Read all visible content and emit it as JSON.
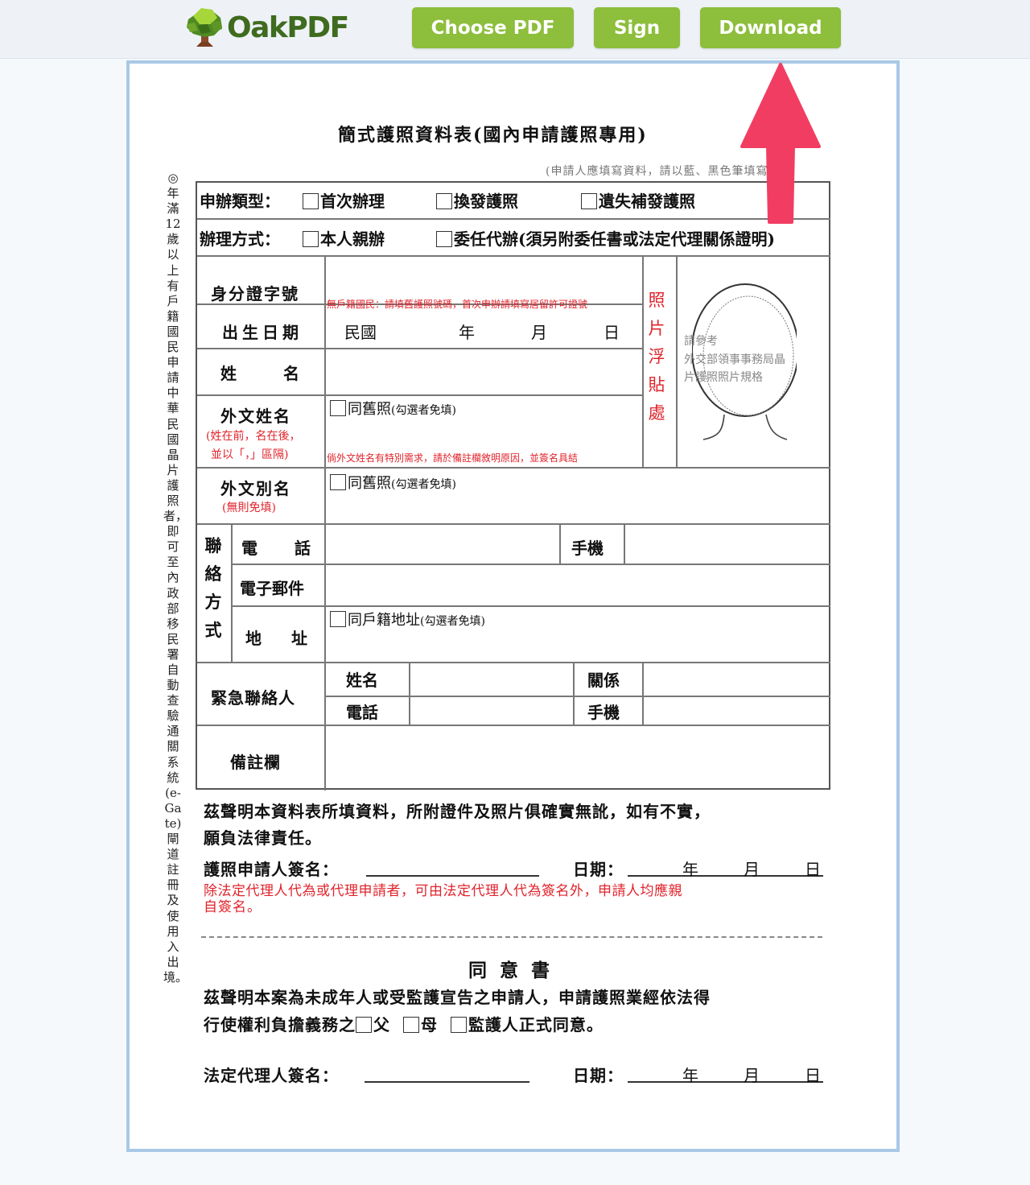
{
  "app": {
    "brand": "OakPDF",
    "toolbar": {
      "choose_pdf": "Choose PDF",
      "sign": "Sign",
      "download": "Download"
    },
    "colors": {
      "button_green": "#8dbe3c",
      "brand_green": "#3f6b1e",
      "page_border": "#a9c8e6",
      "arrow_red": "#f23d63",
      "form_red": "#e0242c"
    },
    "annotation": "red-arrow-pointing-to-download"
  },
  "document": {
    "title": "簡式護照資料表(國內申請護照專用)",
    "subtitle": "(申請人應填寫資料，請以藍、黑色筆填寫)",
    "side_note": "◎年滿12歲以上有戶籍國民申請中華民國晶片護照者，即可至內政部移民署自動查驗通關系統(e-Gate)閘道註冊及使用入出境。",
    "application_type": {
      "label": "申辦類型：",
      "options": [
        "首次辦理",
        "換發護照",
        "遺失補發護照"
      ]
    },
    "processing_method": {
      "label": "辦理方式：",
      "options": [
        "本人親辦",
        "委任代辦(須另附委任書或法定代理關係證明)"
      ]
    },
    "fields": {
      "id_number": {
        "label": "身分證字號",
        "note": "無戶籍國民：請填舊護照號碼，首次申辦請填寫居留許可證號"
      },
      "birth_date": {
        "label": "出生日期",
        "era": "民國",
        "year": "年",
        "month": "月",
        "day": "日"
      },
      "name": {
        "label_1": "姓",
        "label_2": "名"
      },
      "foreign_name": {
        "label": "外文姓名",
        "sub_1": "(姓在前，名在後，",
        "sub_2": "並以「，」區隔)",
        "same_as_old": "同舊照",
        "same_hint": "(勾選者免填)",
        "note": "倘外文姓名有特別需求，請於備註欄敘明原因，並簽名具結"
      },
      "foreign_alias": {
        "label": "外文別名",
        "sub": "(無則免填)",
        "same_as_old": "同舊照",
        "same_hint": "(勾選者免填)"
      },
      "photo": {
        "label": "照片浮貼處",
        "hint_1": "請參考",
        "hint_2": "外交部領事事務局晶",
        "hint_3": "片護照照片規格"
      },
      "contact": {
        "group_label": "聯絡方式",
        "phone_1": "電",
        "phone_2": "話",
        "mobile": "手機",
        "email": "電子郵件",
        "address_1": "地",
        "address_2": "址",
        "same_household": "同戶籍地址",
        "same_hint": "(勾選者免填)"
      },
      "emergency_contact": {
        "label": "緊急聯絡人",
        "name": "姓名",
        "relation": "關係",
        "phone": "電話",
        "mobile": "手機"
      },
      "remarks": {
        "label": "備註欄"
      }
    },
    "declaration": {
      "line_1": "茲聲明本資料表所填資料，所附證件及照片俱確實無訛，如有不實，",
      "line_2": "願負法律責任。",
      "signature_label": "護照申請人簽名：",
      "date_label": "日期：",
      "year": "年",
      "month": "月",
      "day": "日",
      "note_line_1": "除法定代理人代為或代理申請者，可由法定代理人代為簽名外，申請人均應親",
      "note_line_2": "自簽名。"
    },
    "consent": {
      "title": "同 意 書",
      "line_1": "茲聲明本案為未成年人或受監護宣告之申請人，申請護照業經依法得",
      "line_2_prefix": "行使權利負擔義務之",
      "options": [
        "父",
        "母",
        "監護人正式同意。"
      ],
      "signature_label": "法定代理人簽名：",
      "date_label": "日期：",
      "year": "年",
      "month": "月",
      "day": "日"
    }
  }
}
